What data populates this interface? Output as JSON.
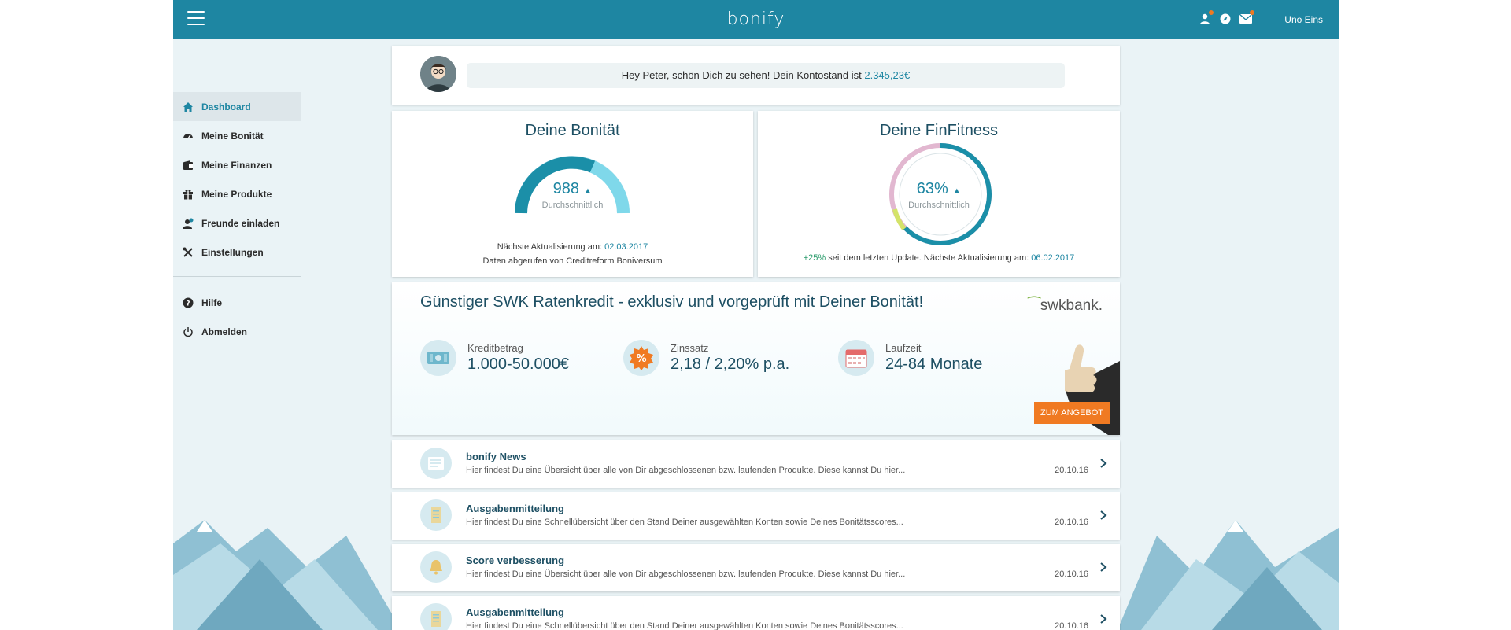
{
  "header": {
    "logo": "bonify",
    "user_name": "Uno Eins"
  },
  "sidebar": {
    "items": [
      {
        "label": "Dashboard",
        "icon": "home-icon"
      },
      {
        "label": "Meine Bonität",
        "icon": "gauge-icon"
      },
      {
        "label": "Meine Finanzen",
        "icon": "wallet-icon"
      },
      {
        "label": "Meine Produkte",
        "icon": "gift-icon"
      },
      {
        "label": "Freunde einladen",
        "icon": "add-friend-icon"
      },
      {
        "label": "Einstellungen",
        "icon": "tools-icon"
      }
    ],
    "secondary": [
      {
        "label": "Hilfe",
        "icon": "help-icon"
      },
      {
        "label": "Abmelden",
        "icon": "power-icon"
      }
    ]
  },
  "greeting": {
    "text": "Hey Peter, schön Dich zu sehen! Dein Kontostand ist",
    "amount": "2.345,23€"
  },
  "score_card": {
    "title": "Deine Bonität",
    "value": "988",
    "rating": "Durchschnittlich",
    "next_update_label": "Nächste Aktualisierung am:",
    "next_update_date": "02.03.2017",
    "source": "Daten abgerufen von Creditreform Boniversum"
  },
  "fitness_card": {
    "title": "Deine FinFitness",
    "value": "63%",
    "level": 0.63,
    "rating": "Durchschnittlich",
    "change": "+25%",
    "change_text": "seit dem letzten Update. Nächste Aktualisierung am:",
    "next_update_date": "06.02.2017"
  },
  "offer": {
    "title": "Günstiger SWK Ratenkredit - exklusiv und vorgeprüft mit Deiner Bonität!",
    "brand": "swkbank.",
    "features": [
      {
        "label": "Kreditbetrag",
        "value": "1.000-50.000€",
        "icon": "money-icon"
      },
      {
        "label": "Zinssatz",
        "value": "2,18 / 2,20% p.a.",
        "icon": "percent-icon"
      },
      {
        "label": "Laufzeit",
        "value": "24-84 Monate",
        "icon": "calendar-icon"
      }
    ],
    "button": "ZUM ANGEBOT"
  },
  "news": [
    {
      "title": "bonify News",
      "text": "Hier findest Du eine Übersicht über alle von Dir abgeschlossenen bzw. laufenden Produkte. Diese kannst Du hier...",
      "date": "20.10.16",
      "icon": "newspaper-icon"
    },
    {
      "title": "Ausgabenmitteilung",
      "text": "Hier findest Du eine Schnellübersicht über den Stand Deiner ausgewählten Konten sowie Deines Bonitätsscores...",
      "date": "20.10.16",
      "icon": "receipt-icon"
    },
    {
      "title": "Score verbesserung",
      "text": "Hier findest Du eine Übersicht über alle von Dir abgeschlossenen bzw. laufenden Produkte. Diese kannst Du hier...",
      "date": "20.10.16",
      "icon": "bell-icon"
    },
    {
      "title": "Ausgabenmitteilung",
      "text": "Hier findest Du eine Schnellübersicht über den Stand Deiner ausgewählten Konten sowie Deines Bonitätsscores...",
      "date": "20.10.16",
      "icon": "receipt-icon"
    }
  ]
}
